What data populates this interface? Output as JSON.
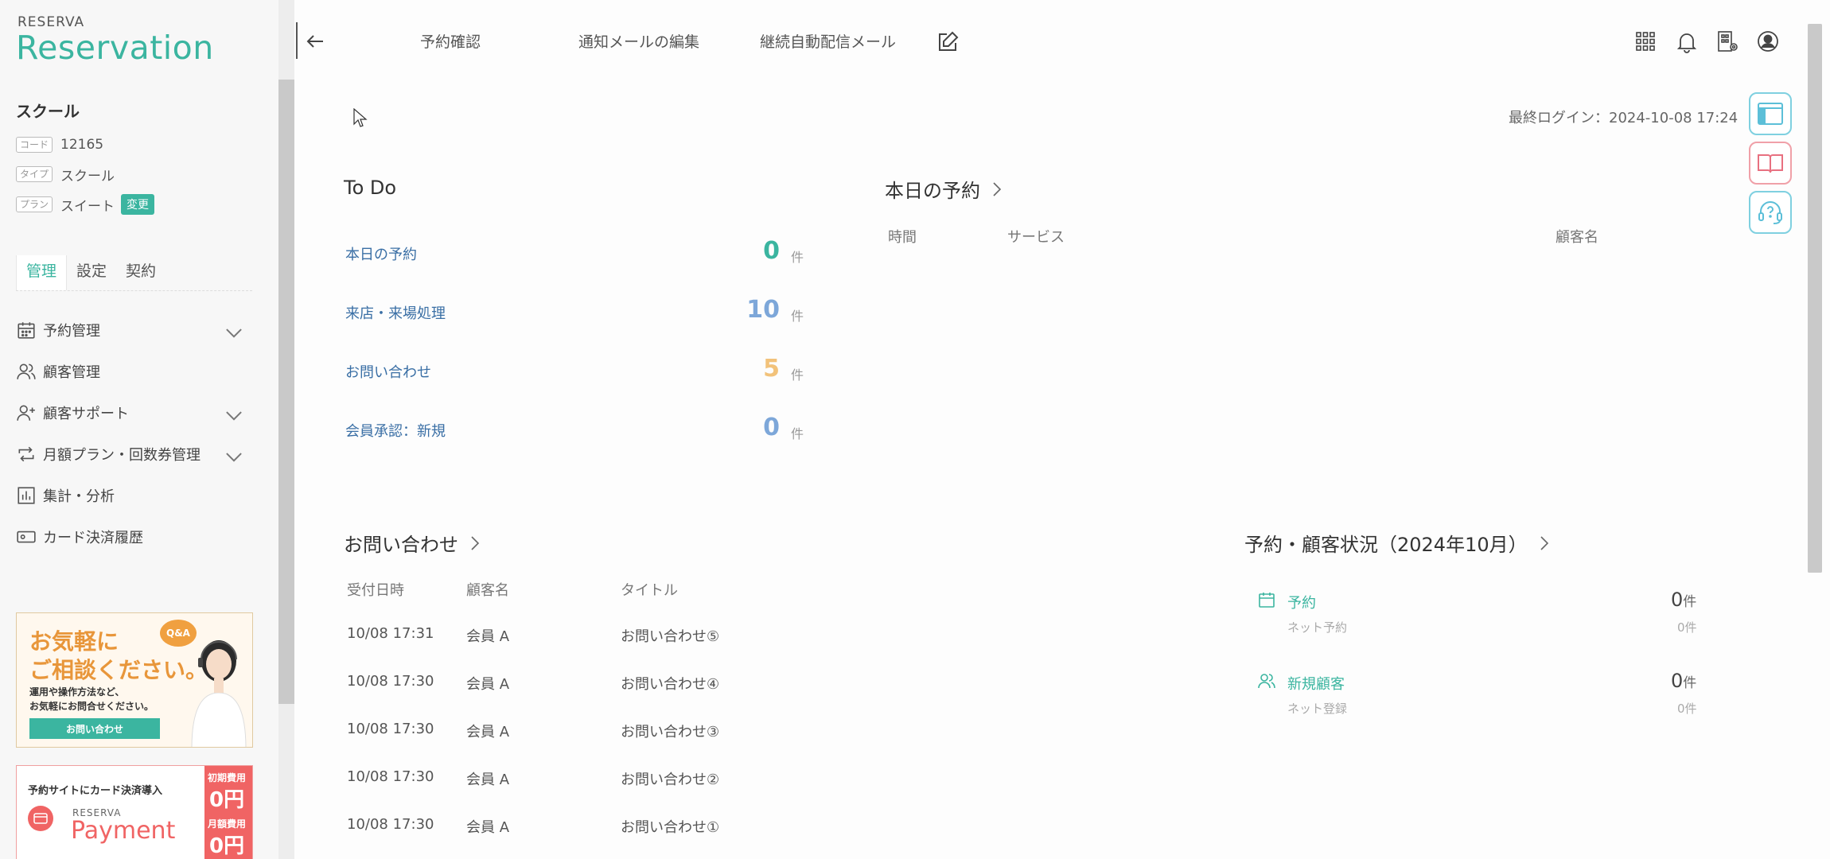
{
  "brand": {
    "small": "RESERVA",
    "big": "Reservation"
  },
  "account": {
    "name": "スクール",
    "rows": [
      {
        "tag": "コード",
        "value": "12165"
      },
      {
        "tag": "タイプ",
        "value": "スクール"
      },
      {
        "tag": "プラン",
        "value": "スイート"
      }
    ],
    "change_label": "変更"
  },
  "sidebar_tabs": [
    "管理",
    "設定",
    "契約"
  ],
  "menu": [
    {
      "label": "予約管理",
      "icon": "calendar-icon",
      "chevron": true
    },
    {
      "label": "顧客管理",
      "icon": "users-icon",
      "chevron": false
    },
    {
      "label": "顧客サポート",
      "icon": "user-plus-icon",
      "chevron": true
    },
    {
      "label": "月額プラン・回数券管理",
      "icon": "repeat-icon",
      "chevron": true
    },
    {
      "label": "集計・分析",
      "icon": "chart-icon",
      "chevron": false
    },
    {
      "label": "カード決済履歴",
      "icon": "card-icon",
      "chevron": false
    }
  ],
  "banner1": {
    "headline1": "お気軽に",
    "headline2": "ご相談ください。",
    "badge": "Q&A",
    "body1": "運用や操作方法など、",
    "body2": "お気軽にお問合せください。",
    "button": "お問い合わせ"
  },
  "banner2": {
    "headline": "予約サイトにカード決済導入",
    "brand_small": "RESERVA",
    "brand_big": "Payment",
    "fee1_label": "初期費用",
    "fee1_value": "0円",
    "fee2_label": "月額費用",
    "fee2_value": "0円"
  },
  "nav": [
    "予約確認",
    "通知メールの編集",
    "継続自動配信メール"
  ],
  "last_login": "最終ログイン：2024-10-08 17:24",
  "todo": {
    "title": "To Do",
    "unit": "件",
    "items": [
      {
        "label": "本日の予約",
        "count": "0",
        "color": "#3bb5a0"
      },
      {
        "label": "来店・来場処理",
        "count": "10",
        "color": "#7da7d9"
      },
      {
        "label": "お問い合わせ",
        "count": "5",
        "color": "#f2c27a"
      },
      {
        "label": "会員承認：新規",
        "count": "0",
        "color": "#7da7d9"
      }
    ]
  },
  "today": {
    "title": "本日の予約",
    "headers": [
      "時間",
      "サービス",
      "顧客名"
    ]
  },
  "inquiries": {
    "title": "お問い合わせ",
    "headers": [
      "受付日時",
      "顧客名",
      "タイトル"
    ],
    "rows": [
      {
        "date": "10/08 17:31",
        "customer": "会員 A",
        "title": "お問い合わせ⑤"
      },
      {
        "date": "10/08 17:30",
        "customer": "会員 A",
        "title": "お問い合わせ④"
      },
      {
        "date": "10/08 17:30",
        "customer": "会員 A",
        "title": "お問い合わせ③"
      },
      {
        "date": "10/08 17:30",
        "customer": "会員 A",
        "title": "お問い合わせ②"
      },
      {
        "date": "10/08 17:30",
        "customer": "会員 A",
        "title": "お問い合わせ①"
      }
    ]
  },
  "status": {
    "title": "予約・顧客状況（2024年10月）",
    "items": [
      {
        "label": "予約",
        "sub": "ネット予約",
        "count": "0",
        "unit": "件",
        "sub_count": "0件",
        "icon": "calendar-icon"
      },
      {
        "label": "新規顧客",
        "sub": "ネット登録",
        "count": "0",
        "unit": "件",
        "sub_count": "0件",
        "icon": "users-icon"
      }
    ]
  }
}
